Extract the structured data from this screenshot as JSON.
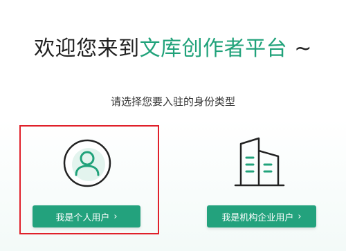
{
  "header": {
    "title_prefix": "欢迎您来到",
    "title_accent": "文库创作者平台",
    "title_suffix": " ~"
  },
  "subtitle": "请选择您要入驻的身份类型",
  "options": {
    "personal": {
      "label": "我是个人用户",
      "chevron": "›"
    },
    "enterprise": {
      "label": "我是机构企业用户",
      "chevron": "›"
    }
  },
  "colors": {
    "accent": "#20a27a",
    "button": "#23a27d",
    "highlight": "#e0202a"
  }
}
